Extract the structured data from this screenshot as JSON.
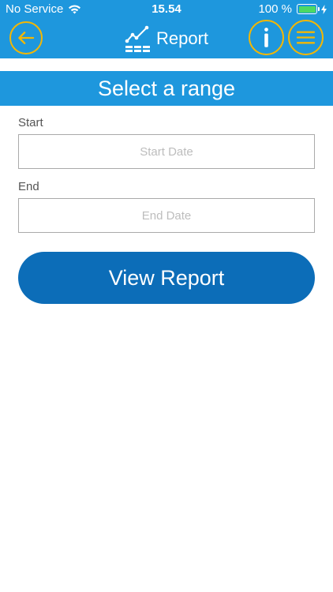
{
  "status_bar": {
    "carrier": "No Service",
    "time": "15.54",
    "battery_pct": "100 %"
  },
  "header": {
    "title": "Report",
    "accent_color": "#f2b705",
    "bar_color": "#1e97dd",
    "icons": [
      "back-arrow-icon",
      "report-chart-icon",
      "info-icon",
      "menu-icon"
    ]
  },
  "section": {
    "title": "Select a range"
  },
  "form": {
    "start_label": "Start",
    "start_placeholder": "Start Date",
    "start_value": "",
    "end_label": "End",
    "end_placeholder": "End Date",
    "end_value": ""
  },
  "actions": {
    "view_report": "View Report",
    "button_color": "#0c6db8"
  }
}
